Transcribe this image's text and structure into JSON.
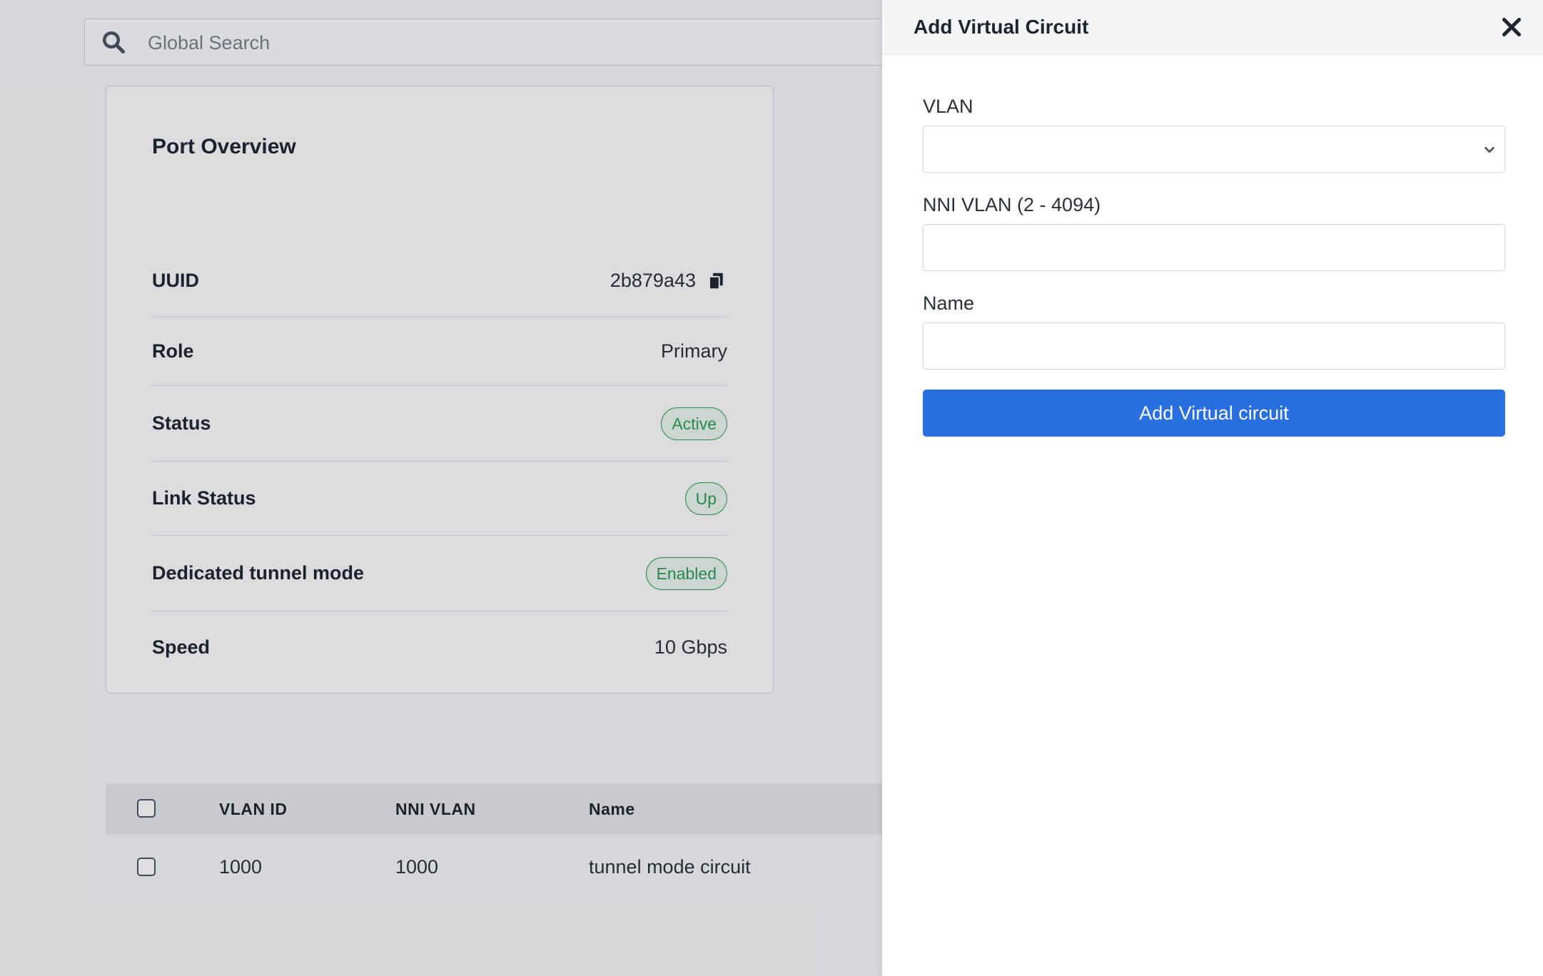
{
  "search": {
    "placeholder": "Global Search"
  },
  "port_overview": {
    "title": "Port Overview",
    "uuid_label": "UUID",
    "uuid_value": "2b879a43",
    "role_label": "Role",
    "role_value": "Primary",
    "status_label": "Status",
    "status_value": "Active",
    "link_status_label": "Link Status",
    "link_status_value": "Up",
    "tunnel_label": "Dedicated tunnel mode",
    "tunnel_value": "Enabled",
    "speed_label": "Speed",
    "speed_value": "10 Gbps"
  },
  "table": {
    "headers": [
      "VLAN ID",
      "NNI VLAN",
      "Name"
    ],
    "rows": [
      {
        "vlan_id": "1000",
        "nni_vlan": "1000",
        "name": "tunnel mode circuit"
      }
    ]
  },
  "panel": {
    "title": "Add Virtual Circuit",
    "vlan_label": "VLAN",
    "vlan_value": "",
    "nni_vlan_label": "NNI VLAN (2 - 4094)",
    "nni_vlan_value": "",
    "name_label": "Name",
    "name_value": "",
    "submit_label": "Add Virtual circuit"
  },
  "colors": {
    "primary": "#2a6fe0",
    "badge_green": "#2f9a55"
  }
}
